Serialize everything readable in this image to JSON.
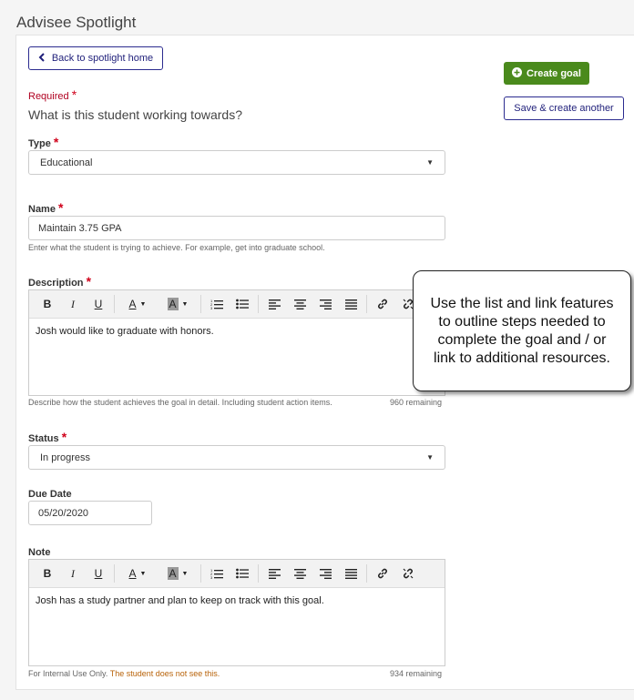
{
  "page": {
    "title": "Advisee Spotlight"
  },
  "nav": {
    "back_label": "Back to spotlight home"
  },
  "form": {
    "required_label": "Required",
    "question": "What is this student working towards?",
    "type": {
      "label": "Type",
      "value": "Educational"
    },
    "name": {
      "label": "Name",
      "value": "Maintain 3.75 GPA",
      "help": "Enter what the student is trying to achieve. For example, get into graduate school."
    },
    "description": {
      "label": "Description",
      "content": "Josh would like to graduate with honors.",
      "help": "Describe how the student achieves the goal in detail. Including student action items.",
      "remaining": "960 remaining"
    },
    "status": {
      "label": "Status",
      "value": "In progress"
    },
    "due_date": {
      "label": "Due Date",
      "value": "05/20/2020"
    },
    "note": {
      "label": "Note",
      "content": "Josh has a study partner and plan to keep on track with this goal.",
      "help_prefix": "For Internal Use Only.",
      "help_warning": "The student does not see this.",
      "remaining": "934 remaining"
    }
  },
  "actions": {
    "create_label": "Create goal",
    "save_another_label": "Save & create another"
  },
  "callout": {
    "text": "Use the list and link features to outline steps needed to complete the goal and / or link to additional resources."
  },
  "toolbar": {
    "bold": "B",
    "italic": "I",
    "underline": "U",
    "text_color": "A",
    "bg_color": "A"
  },
  "colors": {
    "primary_navy": "#1f1f7a",
    "create_green": "#4a8a1c",
    "required_red": "#d0021b",
    "warning_orange": "#b8630a"
  }
}
